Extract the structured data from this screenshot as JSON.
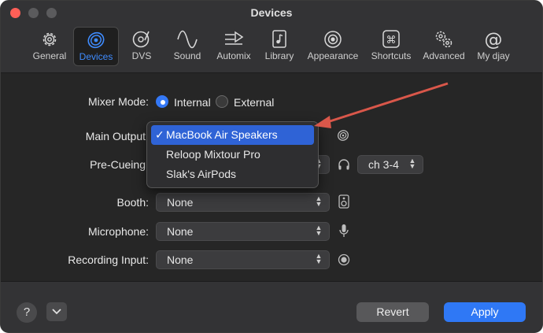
{
  "window": {
    "title": "Devices"
  },
  "toolbar": {
    "items": [
      {
        "label": "General",
        "icon": "gear-icon"
      },
      {
        "label": "Devices",
        "icon": "speaker-icon",
        "active": true
      },
      {
        "label": "DVS",
        "icon": "turntable-icon"
      },
      {
        "label": "Sound",
        "icon": "waveform-icon"
      },
      {
        "label": "Automix",
        "icon": "automix-icon"
      },
      {
        "label": "Library",
        "icon": "library-icon"
      },
      {
        "label": "Appearance",
        "icon": "eye-icon"
      },
      {
        "label": "Shortcuts",
        "icon": "command-key-icon"
      },
      {
        "label": "Advanced",
        "icon": "gears-icon"
      },
      {
        "label": "My djay",
        "icon": "at-sign-icon"
      }
    ]
  },
  "mixer": {
    "label": "Mixer Mode:",
    "options": [
      "Internal",
      "External"
    ],
    "selected": "Internal"
  },
  "main_output": {
    "label": "Main Output",
    "dropdown": {
      "options": [
        "MacBook Air Speakers",
        "Reloop Mixtour Pro",
        "Slak's AirPods"
      ],
      "selected": "MacBook Air Speakers",
      "check": "✓"
    }
  },
  "pre_cueing": {
    "label": "Pre-Cueing",
    "channel": "ch 3-4"
  },
  "booth": {
    "label": "Booth:",
    "value": "None"
  },
  "microphone": {
    "label": "Microphone:",
    "value": "None"
  },
  "recording": {
    "label": "Recording Input:",
    "value": "None"
  },
  "footer": {
    "help": "?",
    "revert": "Revert",
    "apply": "Apply"
  },
  "colors": {
    "accent": "#3478f6",
    "annotation_arrow": "#d9574a"
  }
}
